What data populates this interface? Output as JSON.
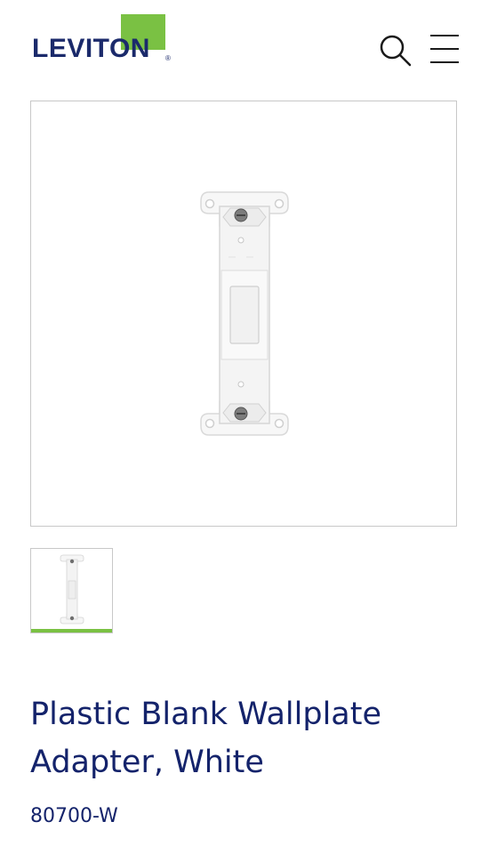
{
  "header": {
    "logo_text": "LEVITON",
    "logo_reg": "®",
    "brand_green": "#7ac143",
    "brand_navy": "#1b2a6b",
    "search_icon": "search-icon",
    "menu_icon": "hamburger-menu-icon"
  },
  "gallery": {
    "main_image": "blank-wallplate-adapter-image",
    "thumbnails": [
      {
        "image": "blank-wallplate-adapter-thumbnail",
        "selected": true
      }
    ]
  },
  "product": {
    "title": "Plastic Blank Wallplate Adapter, White",
    "sku": "80700-W"
  }
}
